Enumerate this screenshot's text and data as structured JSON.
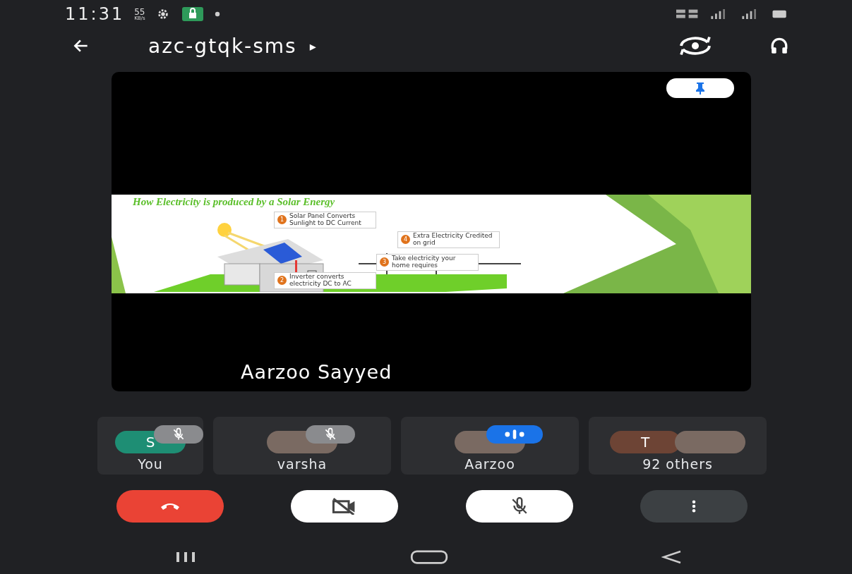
{
  "status_bar": {
    "time": "11:31",
    "speed_value": "55",
    "speed_unit": "KB/s"
  },
  "header": {
    "meeting_code": "azc-gtqk-sms",
    "indicator": "▸"
  },
  "main_tile": {
    "pinned": true,
    "presenter": "Aarzoo Sayyed",
    "slide": {
      "title": "How Electricity is produced by a Solar Energy",
      "callouts": [
        {
          "number": "1",
          "text": "Solar Panel Converts Sunlight to DC Current"
        },
        {
          "number": "4",
          "text": "Extra Electricity Credited on grid"
        },
        {
          "number": "3",
          "text": "Take electricity your home requires"
        },
        {
          "number": "2",
          "text": "Inverter converts electricity DC to AC"
        }
      ]
    }
  },
  "participants": [
    {
      "name": "You",
      "kind": "letter",
      "letter": "S",
      "color": "#1e8e74",
      "muted": true,
      "speaking": false
    },
    {
      "name": "varsha",
      "kind": "photo",
      "muted": true,
      "speaking": false
    },
    {
      "name": "Aarzoo",
      "kind": "photo",
      "muted": false,
      "speaking": true
    },
    {
      "name": "92 others",
      "kind": "group",
      "letter": "T",
      "color": "#6d4435",
      "muted": false,
      "speaking": false
    }
  ],
  "controls": {
    "camera_on": false,
    "mic_on": false
  }
}
